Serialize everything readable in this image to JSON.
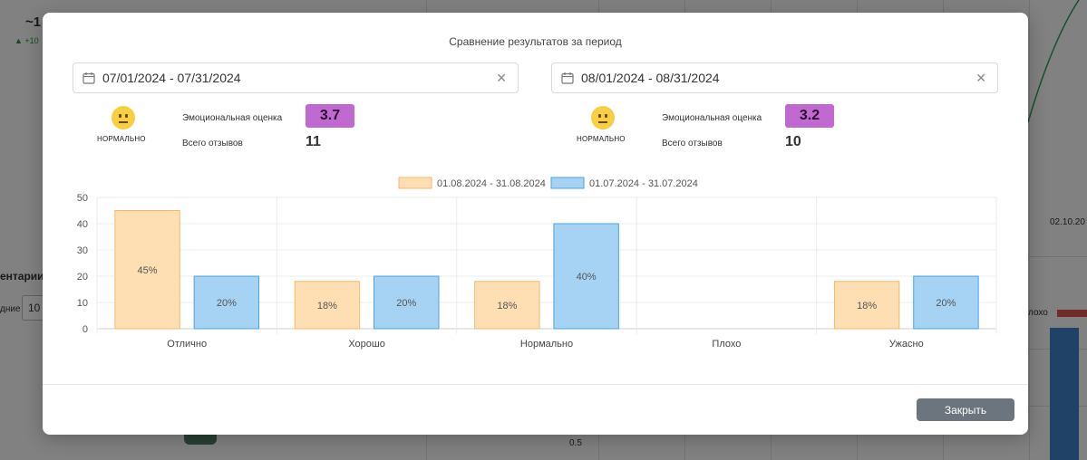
{
  "background": {
    "metric_value": "~1",
    "metric_change": "+10",
    "section_label": "ентарии",
    "period_label": "дние",
    "period_value": "10",
    "date_tick": "02.10.20",
    "legend_bad": "лохо",
    "axis_value": "0.5"
  },
  "modal": {
    "title": "Сравнение результатов за период",
    "left": {
      "date_range": "07/01/2024 - 07/31/2024",
      "mood": "НОРМАЛЬНО",
      "score_label": "Эмоциональная оценка",
      "score": "3.7",
      "reviews_label": "Всего отзывов",
      "reviews": "11"
    },
    "right": {
      "date_range": "08/01/2024 - 08/31/2024",
      "mood": "НОРМАЛЬНО",
      "score_label": "Эмоциональная оценка",
      "score": "3.2",
      "reviews_label": "Всего отзывов",
      "reviews": "10"
    },
    "close_label": "Закрыть",
    "icons": {
      "calendar": "calendar-icon",
      "clear": "close-icon",
      "emoji": "neutral-face-icon"
    },
    "colors": {
      "series_a_fill": "#fddfb3",
      "series_a_stroke": "#f5b96a",
      "series_b_fill": "#a6d3f3",
      "series_b_stroke": "#4ba3e2",
      "score_badge": "#c06ad1",
      "close_button": "#6c757d"
    }
  },
  "chart_data": {
    "type": "bar",
    "categories": [
      "Отлично",
      "Хорошо",
      "Нормально",
      "Плохо",
      "Ужасно"
    ],
    "series": [
      {
        "name": "01.08.2024 - 31.08.2024",
        "values": [
          45,
          18,
          18,
          0,
          18
        ],
        "labels": [
          "45%",
          "18%",
          "18%",
          "",
          "18%"
        ]
      },
      {
        "name": "01.07.2024 - 31.07.2024",
        "values": [
          20,
          20,
          40,
          0,
          20
        ],
        "labels": [
          "20%",
          "20%",
          "40%",
          "",
          "20%"
        ]
      }
    ],
    "ylim": [
      0,
      50
    ],
    "yticks": [
      0,
      10,
      20,
      30,
      40,
      50
    ],
    "grid": true,
    "legend_position": "top-center"
  }
}
